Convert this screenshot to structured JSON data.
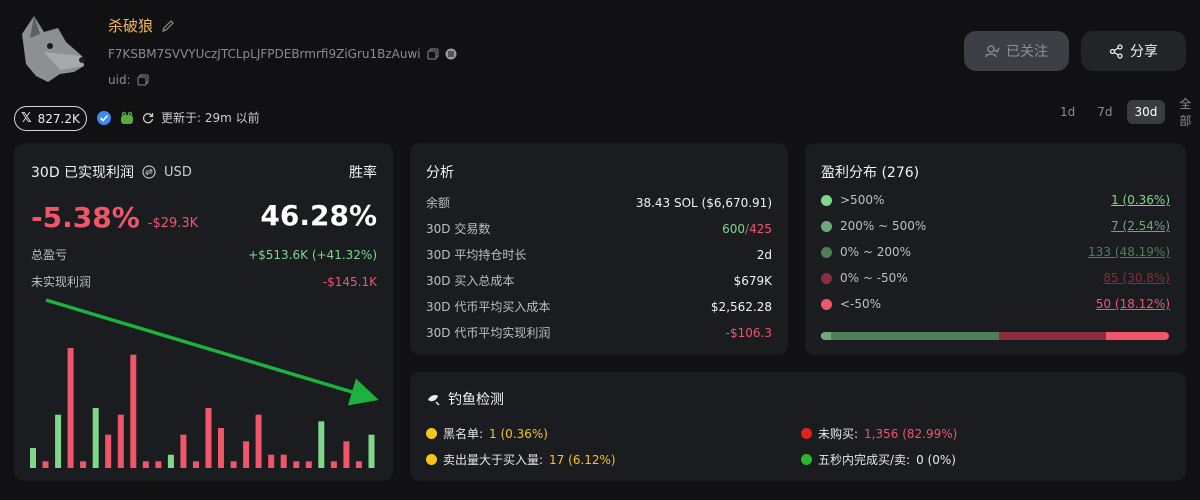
{
  "profile": {
    "name": "杀破狼",
    "address": "F7KSBM7SVVYUczJTCLpLJFPDEBrmrfi9ZiGru1BzAuwi",
    "uid_label": "uid:",
    "follow_label": "已关注",
    "share_label": "分享",
    "x_followers": "827.2K",
    "updated": "更新于: 29m 以前"
  },
  "range": {
    "options": [
      "1d",
      "7d",
      "30d",
      "全部"
    ],
    "active": "30d"
  },
  "pnl": {
    "title": "30D 已实现利润",
    "currency": "USD",
    "winrate_label": "胜率",
    "pct": "-5.38%",
    "usd": "-$29.3K",
    "winrate": "46.28%",
    "total_label": "总盈亏",
    "total_value": "+$513.6K (+41.32%)",
    "unrealized_label": "未实现利润",
    "unrealized_value": "-$145.1K"
  },
  "chart_data": {
    "type": "bar",
    "title": "",
    "xlabel": "",
    "ylabel": "",
    "colors": {
      "positive": "#7fd88a",
      "negative": "#f0566a"
    },
    "values": [
      3,
      -1,
      8,
      -18,
      -1,
      9,
      -5,
      -8,
      -17,
      -1,
      -1,
      2,
      -5,
      -1,
      -9,
      -6,
      -1,
      -4,
      -8,
      -2,
      -2,
      -1,
      -1,
      7,
      -1,
      -4,
      -1,
      5
    ]
  },
  "analysis": {
    "title": "分析",
    "rows": [
      {
        "label": "余额",
        "value": "38.43 SOL ($6,670.91)"
      },
      {
        "label": "30D 交易数",
        "value_green": "600",
        "value_sep": "/",
        "value_red": "425"
      },
      {
        "label": "30D 平均持仓时长",
        "value": "2d"
      },
      {
        "label": "30D 买入总成本",
        "value": "$679K"
      },
      {
        "label": "30D 代币平均买入成本",
        "value": "$2,562.28"
      },
      {
        "label": "30D 代币平均实现利润",
        "value": "-$106.3",
        "color": "#f0566a"
      }
    ]
  },
  "distribution": {
    "title": "盈利分布 (276)",
    "rows": [
      {
        "label": ">500%",
        "value": "1 (0.36%)",
        "color": "#7fd88a",
        "fraction": 0.0036
      },
      {
        "label": "200% ~ 500%",
        "value": "7 (2.54%)",
        "color": "#6fa877",
        "fraction": 0.0254
      },
      {
        "label": "0% ~ 200%",
        "value": "133 (48.19%)",
        "color": "#4f7f58",
        "fraction": 0.4819
      },
      {
        "label": "0% ~ -50%",
        "value": "85 (30.8%)",
        "color": "#8a2d3f",
        "fraction": 0.308
      },
      {
        "label": "<-50%",
        "value": "50 (18.12%)",
        "color": "#f0566a",
        "fraction": 0.1812
      }
    ]
  },
  "phishing": {
    "title": "钓鱼检测",
    "items": [
      {
        "label": "黑名单:",
        "value": "1 (0.36%)",
        "dot": "#f5c518",
        "value_color": "#f5c518"
      },
      {
        "label": "未购买:",
        "value": "1,356 (82.99%)",
        "dot": "#e0221f",
        "value_color": "#f0566a"
      },
      {
        "label": "卖出量大于买入量:",
        "value": "17 (6.12%)",
        "dot": "#f5c518",
        "value_color": "#f5c518"
      },
      {
        "label": "五秒内完成买/卖:",
        "value": "0 (0%)",
        "dot": "#2fb52f",
        "value_color": "#e6e6e6"
      }
    ]
  }
}
